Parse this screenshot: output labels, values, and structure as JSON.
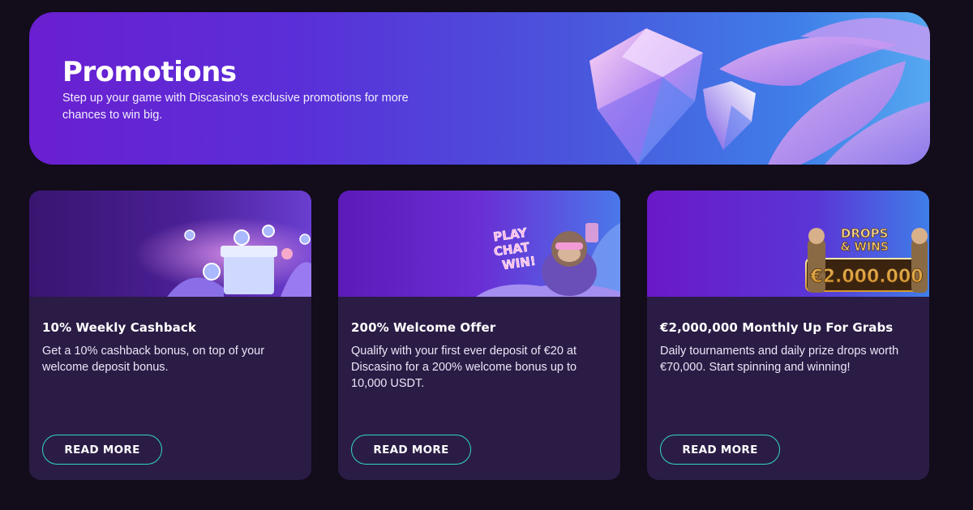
{
  "hero": {
    "title": "Promotions",
    "subtitle": "Step up your game with Discasino's exclusive promotions for more chances to win big."
  },
  "cards": [
    {
      "title": "10% Weekly Cashback",
      "description": "Get a 10% cashback bonus, on top of your welcome deposit bonus.",
      "button": "READ MORE",
      "image_icon": "gift-box-coins-icon"
    },
    {
      "title": "200% Welcome Offer",
      "description": "Qualify with your first ever deposit of €20 at Discasino for a 200% welcome bonus up to 10,000 USDT.",
      "button": "READ MORE",
      "image_icon": "monkey-mascot-icon",
      "image_text": [
        "PLAY",
        "CHAT",
        "WIN!"
      ]
    },
    {
      "title": "€2,000,000 Monthly Up For Grabs",
      "description": "Daily tournaments and daily prize drops worth €70,000. Start spinning and winning!",
      "button": "READ MORE",
      "image_icon": "drops-and-wins-banner-icon",
      "image_text": [
        "DROPS",
        "& WINS",
        "€2.000.000"
      ]
    }
  ],
  "colors": {
    "background": "#120c1b",
    "card": "#2a1c45",
    "button_border": "#34d6c4",
    "hero_start": "#6a1fd0",
    "hero_end": "#55a8f0"
  }
}
